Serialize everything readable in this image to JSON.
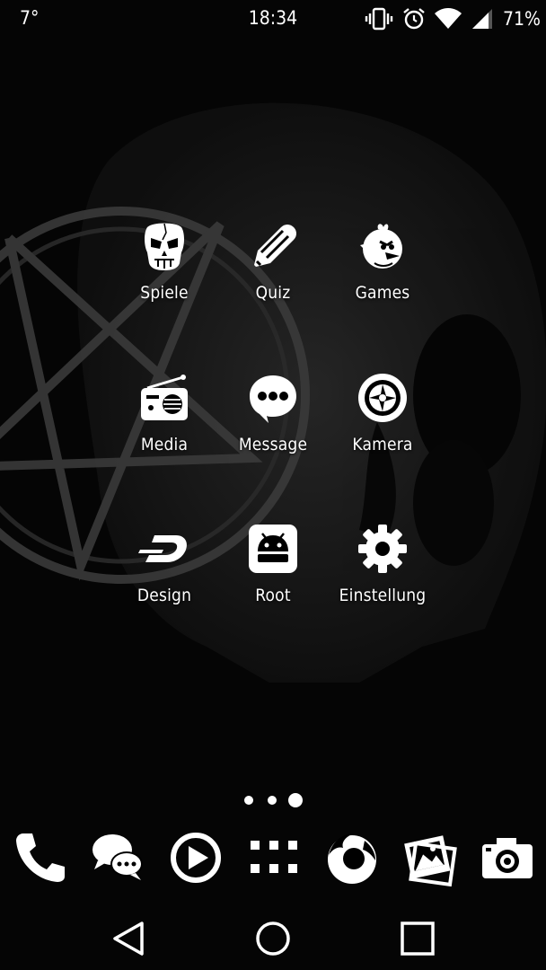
{
  "status_bar": {
    "temperature": "7°",
    "time": "18:34",
    "battery": "71%",
    "icons": [
      "vibrate-icon",
      "alarm-icon",
      "wifi-icon",
      "signal-icon"
    ]
  },
  "home": {
    "apps": [
      {
        "label": "Spiele",
        "icon": "skull-icon"
      },
      {
        "label": "Quiz",
        "icon": "pencil-icon"
      },
      {
        "label": "Games",
        "icon": "angry-bird-icon"
      },
      {
        "label": "Media",
        "icon": "radio-icon"
      },
      {
        "label": "Message",
        "icon": "chat-bubble-icon"
      },
      {
        "label": "Kamera",
        "icon": "aperture-icon"
      },
      {
        "label": "Design",
        "icon": "design-d-icon"
      },
      {
        "label": "Root",
        "icon": "android-icon"
      },
      {
        "label": "Einstellung",
        "icon": "gear-icon"
      }
    ],
    "pages": {
      "count": 3,
      "current": 3
    }
  },
  "dock": [
    "phone-icon",
    "messaging-icon",
    "play-icon",
    "app-drawer-icon",
    "firefox-icon",
    "gallery-icon",
    "camera-icon"
  ],
  "navigation": [
    "back-icon",
    "home-icon",
    "recents-icon"
  ],
  "colors": {
    "background": "#050505",
    "foreground": "#ffffff",
    "wallpaper_art": "#3a3a3a"
  }
}
